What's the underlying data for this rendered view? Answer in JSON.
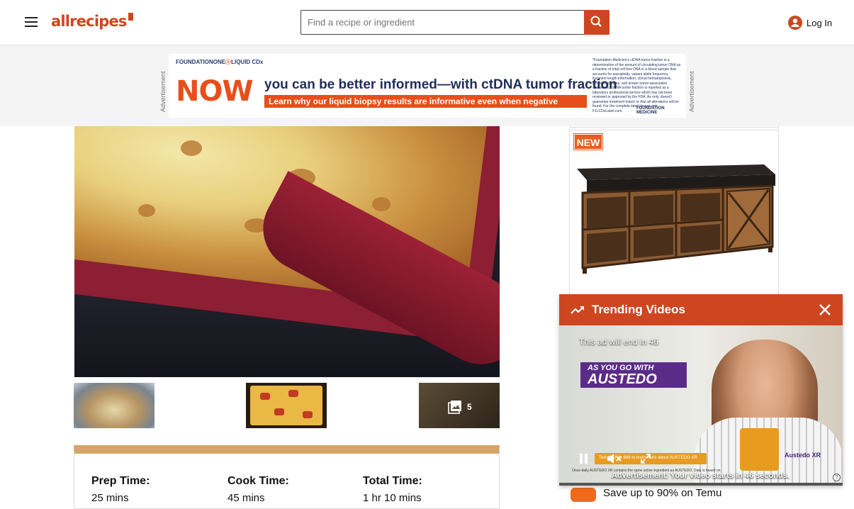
{
  "header": {
    "logo_text": "allrecipes",
    "search_placeholder": "Find a recipe or ingredient",
    "login_label": "Log In"
  },
  "ad_banner": {
    "label": "Advertisement",
    "brand_prefix": "FOUNDATIONONE",
    "brand_suffix": "LIQUID CDx",
    "headline_big": "NOW",
    "headline": "you can be better informed—with ctDNA tumor fraction",
    "subline": "Learn why our liquid biopsy results are informative even when negative",
    "fine_print": "*Foundation Medicine's ctDNA tumor fraction is a determination of the amount of circulating tumor DNA as a fraction of total cell free DNA in a blood sample that accounts for aneuploidy, variant allele frequency, fragment length information, clonal hematopoiesis, germline variants, and known tumor-associated alterations. ctDNA tumor fraction is reported as a laboratory professional service which has not been reviewed or approved by the FDA. As only, doesn't guarantee treatment match or that all alterations will be found. For the complete label please visit F1LCDxLabel.com.",
    "footer_logo": "FOUNDATION MEDICINE"
  },
  "gallery": {
    "more_count": "5"
  },
  "recipe_details": {
    "items": [
      {
        "label": "Prep Time:",
        "value": "25 mins"
      },
      {
        "label": "Cook Time:",
        "value": "45 mins"
      },
      {
        "label": "Total Time:",
        "value": "1 hr 10 mins"
      }
    ]
  },
  "product_ad": {
    "badge": "NEW"
  },
  "video_player": {
    "title": "Trending Videos",
    "ad_end_text": "This ad will end in 46",
    "brand_line1": "AS YOU GO WITH",
    "brand_line2": "AUSTEDO",
    "text_cta": "Text \"GO\" to 669 to learn more about AUSTEDO XR",
    "brand_logo": "Austedo XR",
    "tiny_print": "Once-daily AUSTEDO XR contains the same active ingredient as AUSTEDO. Data is based on",
    "ad_line": "Advertisement: Your video starts in 46 seconds.",
    "help_symbol": "?"
  },
  "temu": {
    "text": "Save up to 90% on Temu"
  },
  "colors": {
    "brand": "#ce4620",
    "card_accent": "#d6a466",
    "new_badge": "#e95d1b"
  }
}
